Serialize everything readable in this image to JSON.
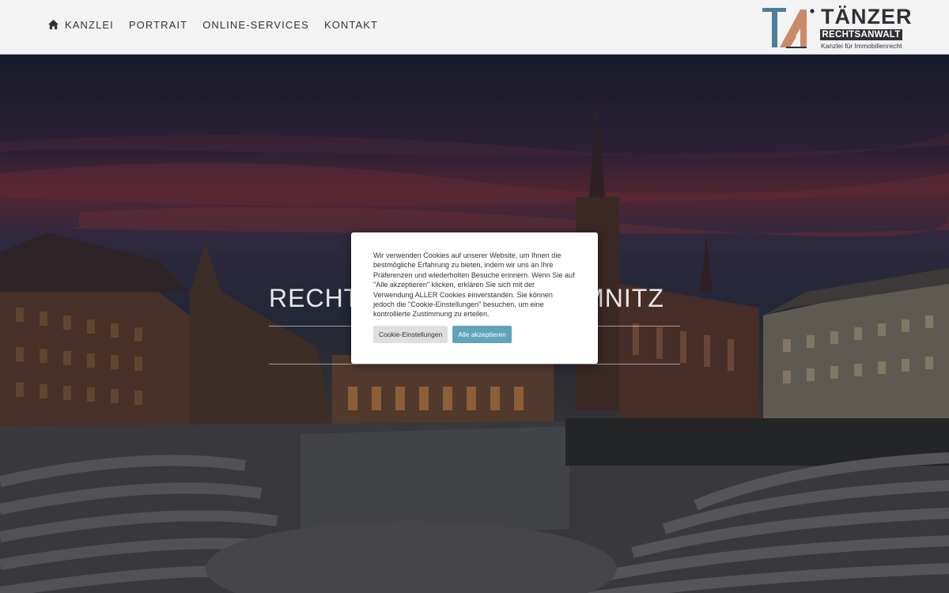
{
  "nav": {
    "items": [
      {
        "label": "KANZLEI",
        "icon": "home-icon"
      },
      {
        "label": "PORTRAIT"
      },
      {
        "label": "ONLINE-SERVICES"
      },
      {
        "label": "KONTAKT"
      }
    ]
  },
  "logo": {
    "mark": "TA",
    "name": "TÄNZER",
    "subtitle": "RECHTSANWALT",
    "tagline": "Kanzlei für Immobilienrecht"
  },
  "hero": {
    "title": "RECHTSANWALT IN CHEMNITZ"
  },
  "cookie": {
    "text": "Wir verwenden Cookies auf unserer Website, um Ihnen die bestmögliche Erfahrung zu bieten, indem wir uns an Ihre Präferenzen und wiederholten Besuche erinnern. Wenn Sie auf \"Alle akzeptieren\" klicken, erklären Sie sich mit der Verwendung ALLER Cookies einverstanden. Sie können jedoch die \"Cookie-Einstellungen\" besuchen, um eine kontrollierte Zustimmung zu erteilen.",
    "settings_label": "Cookie-Einstellungen",
    "accept_label": "Alle akzeptieren"
  },
  "colors": {
    "header_bg": "#f3f3f3",
    "accept_button": "#61a3ba",
    "logo_dark": "#2e3035",
    "logo_accent": "#c98a6a",
    "logo_blue": "#4d7f96"
  }
}
